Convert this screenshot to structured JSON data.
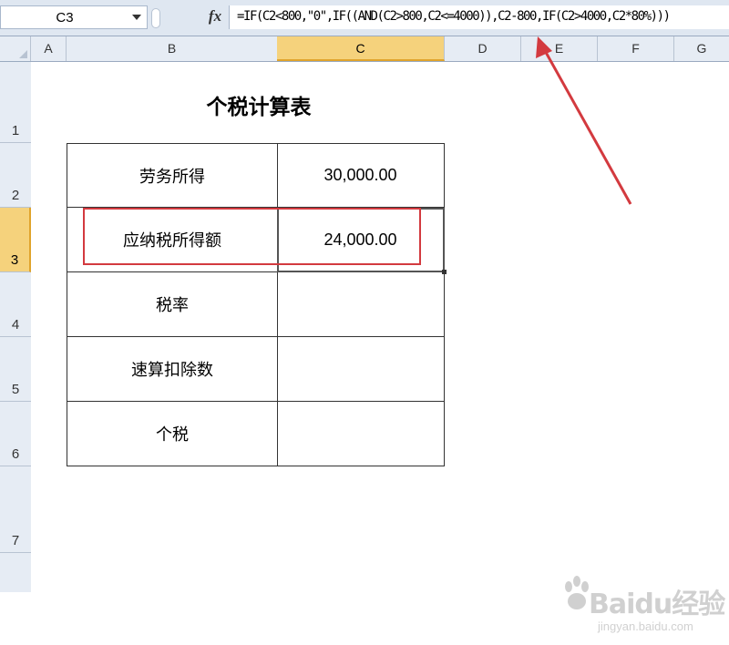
{
  "formula_bar": {
    "name_box": "C3",
    "fx_label": "fx",
    "formula": "=IF(C2<800,\"0\",IF((AND(C2>800,C2<=4000)),C2-800,IF(C2>4000,C2*80%)))"
  },
  "columns": [
    "A",
    "B",
    "C",
    "D",
    "E",
    "F",
    "G"
  ],
  "rows": [
    "1",
    "2",
    "3",
    "4",
    "5",
    "6",
    "7"
  ],
  "selected_cell": "C3",
  "sheet": {
    "title": "个税计算表",
    "table": [
      {
        "label": "劳务所得",
        "value": "30,000.00"
      },
      {
        "label": "应纳税所得额",
        "value": "24,000.00"
      },
      {
        "label": "税率",
        "value": ""
      },
      {
        "label": "速算扣除数",
        "value": ""
      },
      {
        "label": "个税",
        "value": ""
      }
    ]
  },
  "annotations": {
    "highlight_color": "#d33a3f",
    "arrow_color": "#d33a3f"
  },
  "watermark": {
    "brand": "Baidu经验",
    "url": "jingyan.baidu.com"
  }
}
